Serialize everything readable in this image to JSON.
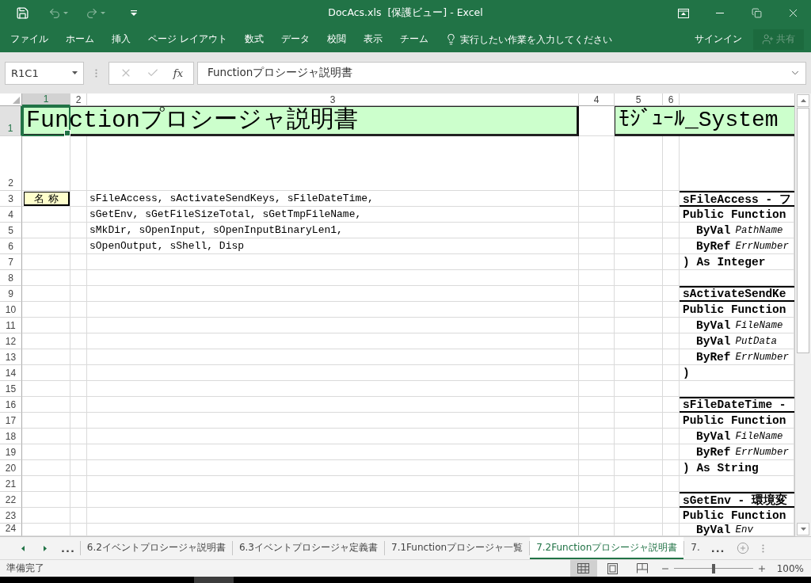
{
  "window": {
    "title": "DocAcs.xls  [保護ビュー] - Excel"
  },
  "quick_access": [
    {
      "kind": "save",
      "disabled": false
    },
    {
      "kind": "undo",
      "disabled": true
    },
    {
      "kind": "redo",
      "disabled": true
    },
    {
      "kind": "customize",
      "disabled": false
    }
  ],
  "ribbon": {
    "tabs": [
      "ファイル",
      "ホーム",
      "挿入",
      "ページ レイアウト",
      "数式",
      "データ",
      "校閲",
      "表示",
      "チーム"
    ],
    "tell_me": {
      "placeholder": "実行したい作業を入力してください"
    },
    "sign_in": "サインイン",
    "share": {
      "label": "共有",
      "disabled": true
    }
  },
  "formula_bar": {
    "name_box": "R1C1",
    "buttons": [
      {
        "kind": "cancel",
        "disabled": true
      },
      {
        "kind": "enter",
        "disabled": true
      }
    ],
    "function_button": "fx",
    "value": "Functionプロシージャ説明書"
  },
  "sheet": {
    "columns": [
      {
        "label": "1",
        "selected": true
      },
      {
        "label": "2",
        "selected": false
      },
      {
        "label": "3",
        "selected": false
      },
      {
        "label": "4",
        "selected": false
      },
      {
        "label": "5",
        "selected": false
      },
      {
        "label": "6",
        "selected": false
      }
    ],
    "rows": [
      {
        "label": "1",
        "selected": true
      },
      {
        "label": "2",
        "selected": false
      },
      {
        "label": "3",
        "selected": false
      },
      {
        "label": "4",
        "selected": false
      },
      {
        "label": "5",
        "selected": false
      },
      {
        "label": "6",
        "selected": false
      },
      {
        "label": "7",
        "selected": false
      },
      {
        "label": "8",
        "selected": false
      },
      {
        "label": "9",
        "selected": false
      },
      {
        "label": "10",
        "selected": false
      },
      {
        "label": "11",
        "selected": false
      },
      {
        "label": "12",
        "selected": false
      },
      {
        "label": "13",
        "selected": false
      },
      {
        "label": "14",
        "selected": false
      },
      {
        "label": "15",
        "selected": false
      },
      {
        "label": "16",
        "selected": false
      },
      {
        "label": "17",
        "selected": false
      },
      {
        "label": "18",
        "selected": false
      },
      {
        "label": "19",
        "selected": false
      },
      {
        "label": "20",
        "selected": false
      },
      {
        "label": "21",
        "selected": false
      },
      {
        "label": "22",
        "selected": false
      },
      {
        "label": "23",
        "selected": false
      },
      {
        "label": "24",
        "selected": false
      }
    ],
    "title": "Functionプロシージャ説明書",
    "module_title": "ﾓｼﾞｭｰﾙ_System",
    "name_label": "名 称",
    "name_lines": [
      "sFileAccess, sActivateSendKeys, sFileDateTime,",
      "sGetEnv, sGetFileSizeTotal, sGetTmpFileName,",
      "sMkDir, sOpenInput, sOpenInputBinaryLen1,",
      "sOpenOutput, sShell, Disp"
    ],
    "procedures": [
      {
        "heading": "sFileAccess - フ",
        "declaration": "Public Function",
        "params": [
          {
            "passing": "ByVal",
            "name": "PathName"
          },
          {
            "passing": "ByRef",
            "name": "ErrNumber"
          }
        ],
        "closing": ") As Integer"
      },
      {
        "heading": "sActivateSendKe",
        "declaration": "Public Function",
        "params": [
          {
            "passing": "ByVal",
            "name": "FileName"
          },
          {
            "passing": "ByVal",
            "name": "PutData"
          },
          {
            "passing": "ByRef",
            "name": "ErrNumber"
          }
        ],
        "closing": ")"
      },
      {
        "heading": "sFileDateTime -",
        "declaration": "Public Function",
        "params": [
          {
            "passing": "ByVal",
            "name": "FileName"
          },
          {
            "passing": "ByRef",
            "name": "ErrNumber"
          }
        ],
        "closing": ") As String"
      },
      {
        "heading": "sGetEnv - 環境変",
        "declaration": "Public Function",
        "params": [
          {
            "passing": "ByVal",
            "name": "Env"
          }
        ]
      }
    ]
  },
  "sheet_tabs": {
    "scroll_more": "...",
    "tabs": [
      {
        "label": "6.2イベントプロシージャ説明書",
        "selected": false
      },
      {
        "label": "6.3イベントプロシージャ定義書",
        "selected": false
      },
      {
        "label": "7.1Functionプロシージャ一覧",
        "selected": false
      },
      {
        "label": "7.2Functionプロシージャ説明書",
        "selected": true
      },
      {
        "label": "7.",
        "selected": false
      }
    ],
    "more": "..."
  },
  "status_bar": {
    "status": "準備完了",
    "views": [
      {
        "kind": "normal",
        "selected": true
      },
      {
        "kind": "page_layout",
        "selected": false
      },
      {
        "kind": "page_break",
        "selected": false
      }
    ],
    "zoom": {
      "level": 0.5,
      "reading": "100%"
    }
  }
}
